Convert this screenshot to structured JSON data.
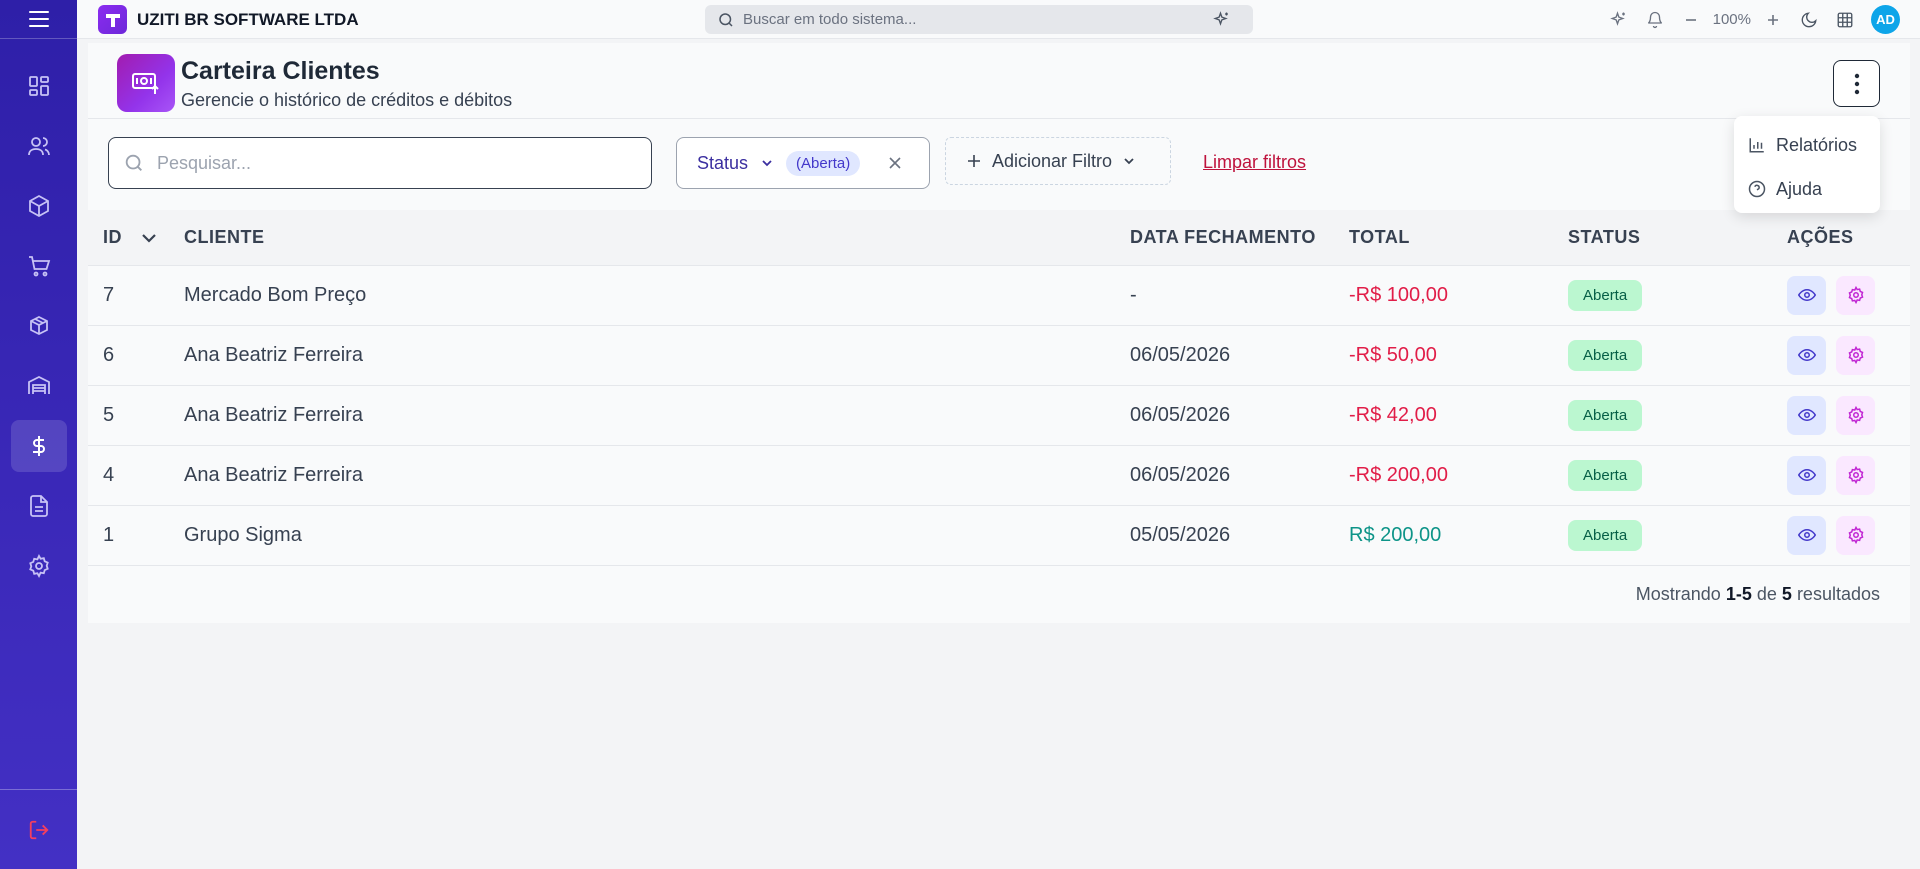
{
  "topbar": {
    "company": "UZITI BR SOFTWARE LTDA",
    "search_placeholder": "Buscar em todo sistema...",
    "zoom": "100%",
    "avatar_initials": "AD"
  },
  "page": {
    "title": "Carteira Clientes",
    "subtitle": "Gerencie o histórico de créditos e débitos"
  },
  "filters": {
    "search_placeholder": "Pesquisar...",
    "status_label": "Status",
    "status_value": "(Aberta)",
    "add_filter_label": "Adicionar Filtro",
    "clear_label": "Limpar filtros"
  },
  "dropdown": {
    "items": [
      {
        "label": "Relatórios",
        "icon": "bar-chart-icon"
      },
      {
        "label": "Ajuda",
        "icon": "help-circle-icon"
      }
    ]
  },
  "table": {
    "headers": {
      "id": "ID",
      "cliente": "CLIENTE",
      "data": "DATA FECHAMENTO",
      "total": "TOTAL",
      "status": "STATUS",
      "acoes": "AÇÕES"
    },
    "rows": [
      {
        "id": "7",
        "cliente": "Mercado Bom Preço",
        "data": "-",
        "total": "-R$ 100,00",
        "status": "Aberta",
        "sign": "neg"
      },
      {
        "id": "6",
        "cliente": "Ana Beatriz Ferreira",
        "data": "06/05/2026",
        "total": "-R$ 50,00",
        "status": "Aberta",
        "sign": "neg"
      },
      {
        "id": "5",
        "cliente": "Ana Beatriz Ferreira",
        "data": "06/05/2026",
        "total": "-R$ 42,00",
        "status": "Aberta",
        "sign": "neg"
      },
      {
        "id": "4",
        "cliente": "Ana Beatriz Ferreira",
        "data": "06/05/2026",
        "total": "-R$ 200,00",
        "status": "Aberta",
        "sign": "neg"
      },
      {
        "id": "1",
        "cliente": "Grupo Sigma",
        "data": "05/05/2026",
        "total": "R$ 200,00",
        "status": "Aberta",
        "sign": "pos"
      }
    ]
  },
  "pagination": {
    "prefix": "Mostrando",
    "range": "1-5",
    "of": "de",
    "total": "5",
    "suffix": "resultados"
  },
  "colors": {
    "sidebar": "#3a28b8",
    "accent": "#9333ea",
    "negative": "#e11d48",
    "positive": "#0d9488",
    "badge_bg": "#bbf7d0"
  }
}
